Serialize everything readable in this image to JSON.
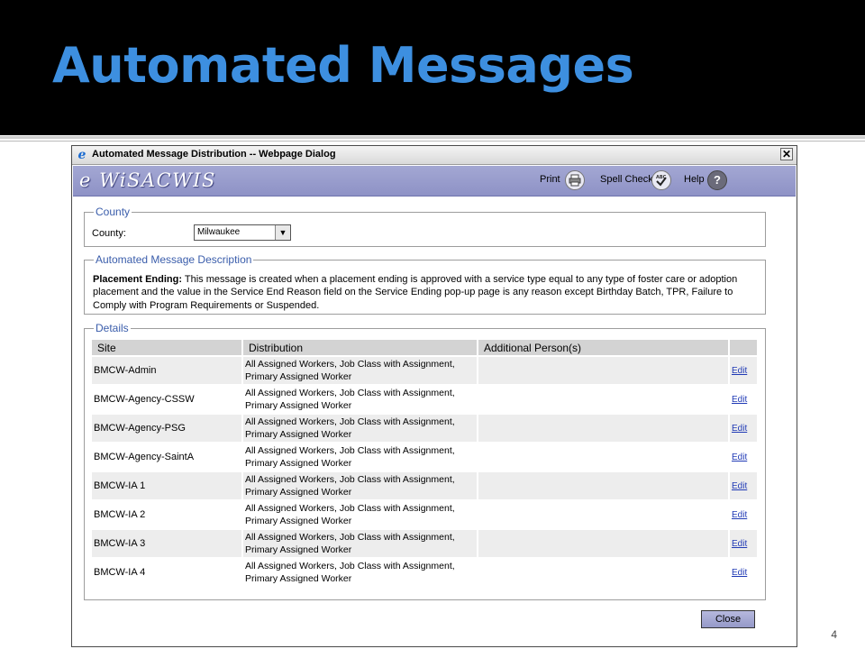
{
  "slide": {
    "title": "Automated Messages",
    "page_number": "4"
  },
  "dialog": {
    "window_title": "Automated Message Distribution -- Webpage Dialog",
    "close_glyph": "✕",
    "app_name": "e WiSACWIS",
    "toolbar": {
      "print_label": "Print",
      "spell_check_label": "Spell Check",
      "help_label": "Help",
      "help_glyph": "?"
    },
    "county_section": {
      "legend": "County",
      "label": "County:",
      "selected_value": "Milwaukee"
    },
    "description_section": {
      "legend": "Automated Message Description",
      "heading": "Placement Ending:",
      "text": " This message is created when a placement ending is approved with a service type equal to any type of foster care or adoption placement and the value in the Service End Reason field on the Service Ending pop-up page is any reason except Birthday Batch, TPR, Failure to Comply with Program Requirements or Suspended."
    },
    "details_section": {
      "legend": "Details",
      "columns": [
        "Site",
        "Distribution",
        "Additional Person(s)",
        ""
      ],
      "rows": [
        {
          "site": "BMCW-Admin",
          "distribution_line1": "All Assigned Workers, Job Class with Assignment,",
          "distribution_line2": "Primary Assigned Worker",
          "additional": "",
          "action": "Edit"
        },
        {
          "site": "BMCW-Agency-CSSW",
          "distribution_line1": "All Assigned Workers, Job Class with Assignment,",
          "distribution_line2": "Primary Assigned Worker",
          "additional": "",
          "action": "Edit"
        },
        {
          "site": "BMCW-Agency-PSG",
          "distribution_line1": "All Assigned Workers, Job Class with Assignment,",
          "distribution_line2": "Primary Assigned Worker",
          "additional": "",
          "action": "Edit"
        },
        {
          "site": "BMCW-Agency-SaintA",
          "distribution_line1": "All Assigned Workers, Job Class with Assignment,",
          "distribution_line2": "Primary Assigned Worker",
          "additional": "",
          "action": "Edit"
        },
        {
          "site": "BMCW-IA 1",
          "distribution_line1": "All Assigned Workers, Job Class with Assignment,",
          "distribution_line2": "Primary Assigned Worker",
          "additional": "",
          "action": "Edit"
        },
        {
          "site": "BMCW-IA 2",
          "distribution_line1": "All Assigned Workers, Job Class with Assignment,",
          "distribution_line2": "Primary Assigned Worker",
          "additional": "",
          "action": "Edit"
        },
        {
          "site": "BMCW-IA 3",
          "distribution_line1": "All Assigned Workers, Job Class with Assignment,",
          "distribution_line2": "Primary Assigned Worker",
          "additional": "",
          "action": "Edit"
        },
        {
          "site": "BMCW-IA 4",
          "distribution_line1": "All Assigned Workers, Job Class with Assignment,",
          "distribution_line2": "Primary Assigned Worker",
          "additional": "",
          "action": "Edit"
        }
      ]
    },
    "close_button_label": "Close"
  },
  "colors": {
    "title_blue": "#3d8fe0",
    "app_bar": "#9a9ecd",
    "legend_blue": "#3a5dab",
    "link_blue": "#1f39b5"
  },
  "icons": {
    "browser": "ie-icon",
    "print": "printer-icon",
    "spell_check": "spell-check-icon",
    "help": "help-icon",
    "county_dropdown": "chevron-down-icon"
  }
}
